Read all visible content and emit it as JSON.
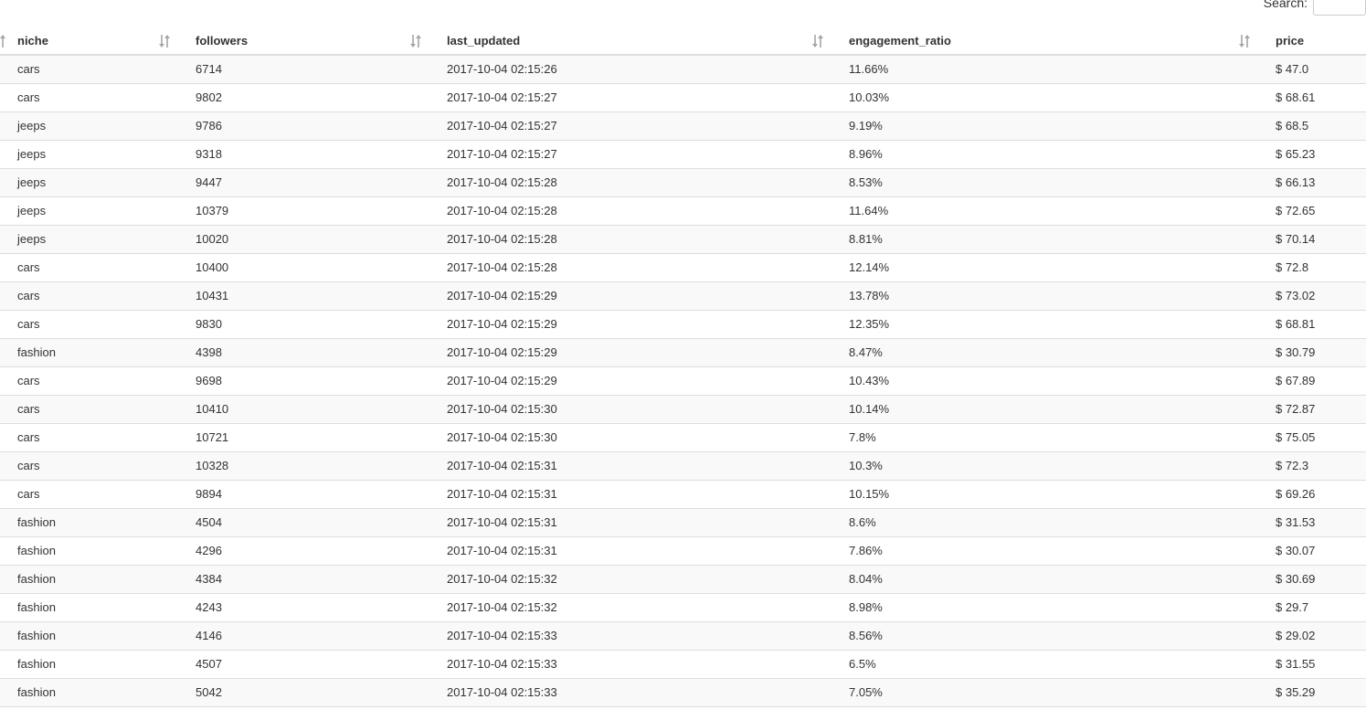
{
  "search": {
    "label": "Search:",
    "value": ""
  },
  "table": {
    "columns": [
      "niche",
      "followers",
      "last_updated",
      "engagement_ratio",
      "price"
    ],
    "rows": [
      [
        "cars",
        "6714",
        "2017-10-04 02:15:26",
        "11.66%",
        "$ 47.0"
      ],
      [
        "cars",
        "9802",
        "2017-10-04 02:15:27",
        "10.03%",
        "$ 68.61"
      ],
      [
        "jeeps",
        "9786",
        "2017-10-04 02:15:27",
        "9.19%",
        "$ 68.5"
      ],
      [
        "jeeps",
        "9318",
        "2017-10-04 02:15:27",
        "8.96%",
        "$ 65.23"
      ],
      [
        "jeeps",
        "9447",
        "2017-10-04 02:15:28",
        "8.53%",
        "$ 66.13"
      ],
      [
        "jeeps",
        "10379",
        "2017-10-04 02:15:28",
        "11.64%",
        "$ 72.65"
      ],
      [
        "jeeps",
        "10020",
        "2017-10-04 02:15:28",
        "8.81%",
        "$ 70.14"
      ],
      [
        "cars",
        "10400",
        "2017-10-04 02:15:28",
        "12.14%",
        "$ 72.8"
      ],
      [
        "cars",
        "10431",
        "2017-10-04 02:15:29",
        "13.78%",
        "$ 73.02"
      ],
      [
        "cars",
        "9830",
        "2017-10-04 02:15:29",
        "12.35%",
        "$ 68.81"
      ],
      [
        "fashion",
        "4398",
        "2017-10-04 02:15:29",
        "8.47%",
        "$ 30.79"
      ],
      [
        "cars",
        "9698",
        "2017-10-04 02:15:29",
        "10.43%",
        "$ 67.89"
      ],
      [
        "cars",
        "10410",
        "2017-10-04 02:15:30",
        "10.14%",
        "$ 72.87"
      ],
      [
        "cars",
        "10721",
        "2017-10-04 02:15:30",
        "7.8%",
        "$ 75.05"
      ],
      [
        "cars",
        "10328",
        "2017-10-04 02:15:31",
        "10.3%",
        "$ 72.3"
      ],
      [
        "cars",
        "9894",
        "2017-10-04 02:15:31",
        "10.15%",
        "$ 69.26"
      ],
      [
        "fashion",
        "4504",
        "2017-10-04 02:15:31",
        "8.6%",
        "$ 31.53"
      ],
      [
        "fashion",
        "4296",
        "2017-10-04 02:15:31",
        "7.86%",
        "$ 30.07"
      ],
      [
        "fashion",
        "4384",
        "2017-10-04 02:15:32",
        "8.04%",
        "$ 30.69"
      ],
      [
        "fashion",
        "4243",
        "2017-10-04 02:15:32",
        "8.98%",
        "$ 29.7"
      ],
      [
        "fashion",
        "4146",
        "2017-10-04 02:15:33",
        "8.56%",
        "$ 29.02"
      ],
      [
        "fashion",
        "4507",
        "2017-10-04 02:15:33",
        "6.5%",
        "$ 31.55"
      ],
      [
        "fashion",
        "5042",
        "2017-10-04 02:15:33",
        "7.05%",
        "$ 35.29"
      ]
    ]
  }
}
